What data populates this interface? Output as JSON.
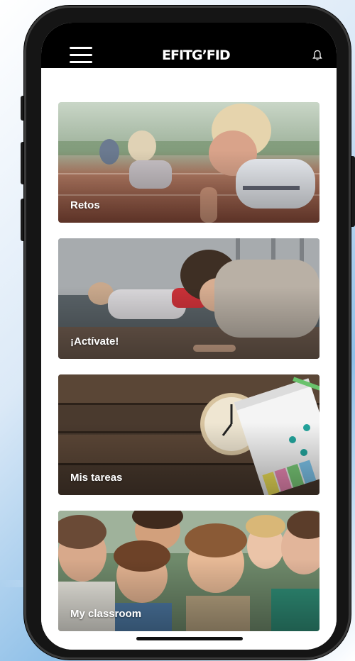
{
  "app": {
    "logo_text": "EFITG’FID"
  },
  "header": {
    "menu_icon": "hamburger-menu-icon",
    "notification_icon": "bell-icon"
  },
  "cards": [
    {
      "label": "Retos"
    },
    {
      "label": "¡Actívate!"
    },
    {
      "label": "Mis tareas"
    },
    {
      "label": "My classroom"
    }
  ],
  "colors": {
    "topbar": "#000000",
    "screen": "#ffffff",
    "card_label": "#ffffff"
  }
}
